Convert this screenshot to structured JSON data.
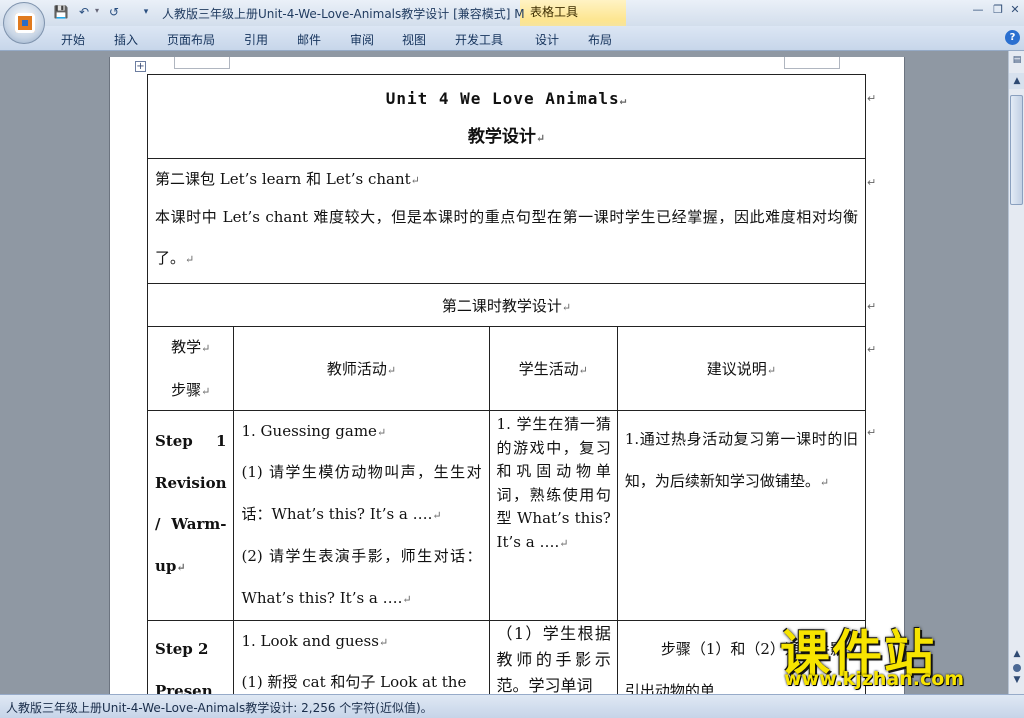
{
  "window": {
    "title": "人教版三年级上册Unit-4-We-Love-Animals教学设计 [兼容模式] M",
    "contextual_group": "表格工具"
  },
  "quick_access": {
    "save": "save-icon",
    "undo": "undo-icon",
    "redo": "redo-icon",
    "customize": "chevron-down-icon"
  },
  "ribbon": {
    "tabs": [
      "开始",
      "插入",
      "页面布局",
      "引用",
      "邮件",
      "审阅",
      "视图",
      "开发工具",
      "设计",
      "布局"
    ]
  },
  "document": {
    "title_line": "Unit 4 We Love Animals",
    "subtitle": "教学设计",
    "intro_line1": "第二课包 Let’s learn 和 Let’s chant",
    "intro_line2": "本课时中 Let’s chant 难度较大，但是本课时的重点句型在第一课时学生已经掌握，因此难度相对均衡了。",
    "section_title": "第二课时教学设计",
    "headers": {
      "step_line1": "教学",
      "step_line2": "步骤",
      "teacher": "教师活动",
      "student": "学生活动",
      "notes": "建议说明"
    },
    "rows": [
      {
        "step": "Step 1 Revision / Warm-up",
        "teacher_lines": [
          "1.  Guessing game",
          "(1) 请学生模仿动物叫声，生生对话：What’s this? It’s a ….",
          "(2) 请学生表演手影，师生对话：What’s this? It’s a …."
        ],
        "student": "1. 学生在猜一猜的游戏中，复习和巩固动物单词，熟练使用句型 What’s this? It’s a ….",
        "notes": "1.通过热身活动复习第一课时的旧知，为后续新知学习做铺垫。"
      },
      {
        "step": "Step 2 Presen",
        "teacher_lines": [
          "1.  Look and guess",
          "(1) 新授 cat 和句子 Look at the"
        ],
        "student": "（1）学生根据教师的手影示范。学习单词",
        "notes": "步骤（1）和（2）通过手影引出动物的单"
      }
    ]
  },
  "status_bar": {
    "text": "人教版三年级上册Unit-4-We-Love-Animals教学设计: 2,256 个字符(近似值)。"
  },
  "watermark": {
    "text": "课件站",
    "url": "www.kjzhan.com"
  }
}
